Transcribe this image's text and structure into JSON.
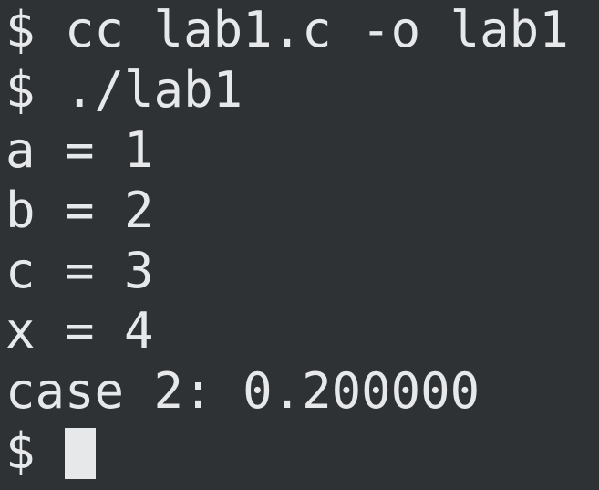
{
  "terminal": {
    "lines": [
      "$ cc lab1.c -o lab1",
      "$ ./lab1",
      "a = 1",
      "b = 2",
      "c = 3",
      "x = 4",
      "case 2: 0.200000"
    ],
    "prompt": "$"
  },
  "colors": {
    "background": "#2f3235",
    "foreground": "#e6e8ea",
    "cursor": "#e6e8ea"
  }
}
